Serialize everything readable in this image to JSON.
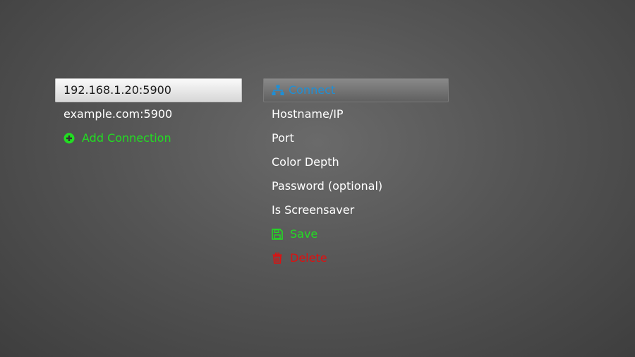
{
  "connections": {
    "items": [
      {
        "label": "192.168.1.20:5900"
      },
      {
        "label": "example.com:5900"
      }
    ],
    "add_label": "Add Connection"
  },
  "menu": {
    "connect_label": "Connect",
    "hostname_label": "Hostname/IP",
    "port_label": "Port",
    "color_depth_label": "Color Depth",
    "password_label": "Password (optional)",
    "screensaver_label": "Is Screensaver",
    "save_label": "Save",
    "delete_label": "Delete"
  },
  "colors": {
    "accent_blue": "#1e8fd6",
    "add_green": "#22dd22",
    "delete_red": "#dd1111"
  },
  "icons": {
    "add": "plus-circle-icon",
    "connect": "network-icon",
    "save": "floppy-disk-icon",
    "delete": "trash-icon"
  }
}
